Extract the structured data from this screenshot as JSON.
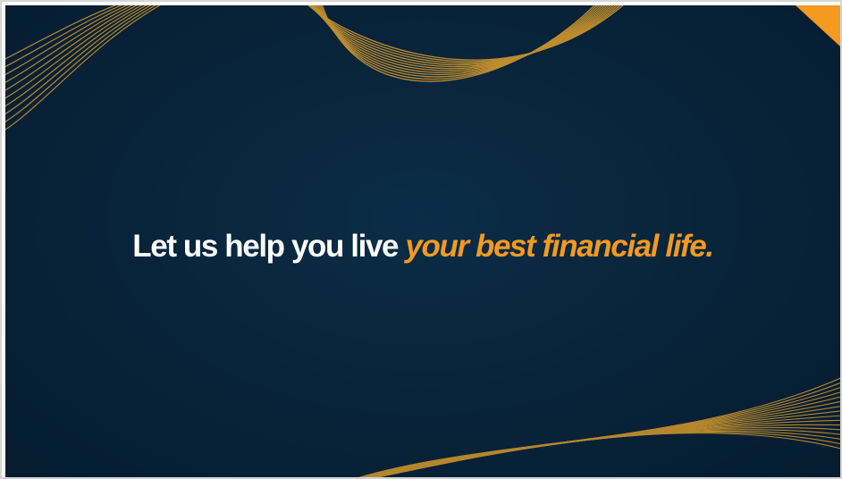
{
  "headline": {
    "plain_text": "Let us help you live ",
    "accent_text": "your best financial life",
    "terminal_punct": "."
  },
  "colors": {
    "background": "#082339",
    "accent": "#f39a1f",
    "line_gold": "#c8932e",
    "text": "#ffffff"
  },
  "decorations": {
    "top_left": "gold-wave-lines",
    "top_center": "gold-wave-lines",
    "top_right": "orange-corner-triangle",
    "bottom_right": "gold-wave-lines"
  }
}
